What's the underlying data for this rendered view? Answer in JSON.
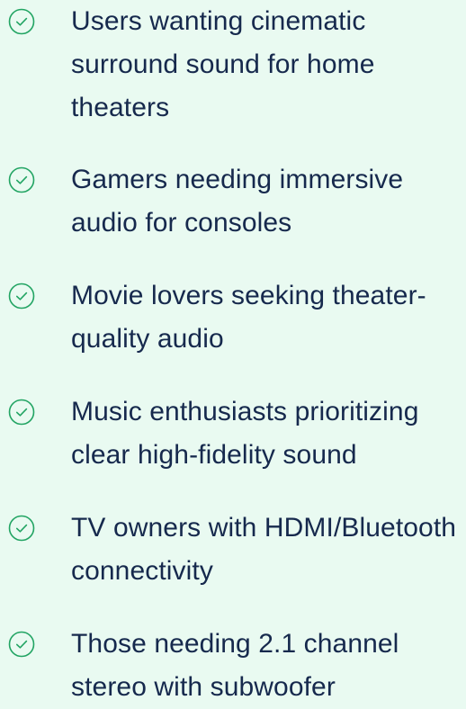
{
  "features": {
    "icon": "check-circle-icon",
    "icon_color": "#22a463",
    "text_color": "#16294d",
    "background": "#e9faf1",
    "items": [
      {
        "label": "Users wanting cinematic surround sound for home theaters"
      },
      {
        "label": "Gamers needing immersive audio for consoles"
      },
      {
        "label": "Movie lovers seeking theater-quality audio"
      },
      {
        "label": "Music enthusiasts prioritizing clear high-fidelity sound"
      },
      {
        "label": "TV owners with HDMI/Bluetooth connectivity"
      },
      {
        "label": "Those needing 2.1 channel stereo with subwoofer"
      }
    ]
  }
}
